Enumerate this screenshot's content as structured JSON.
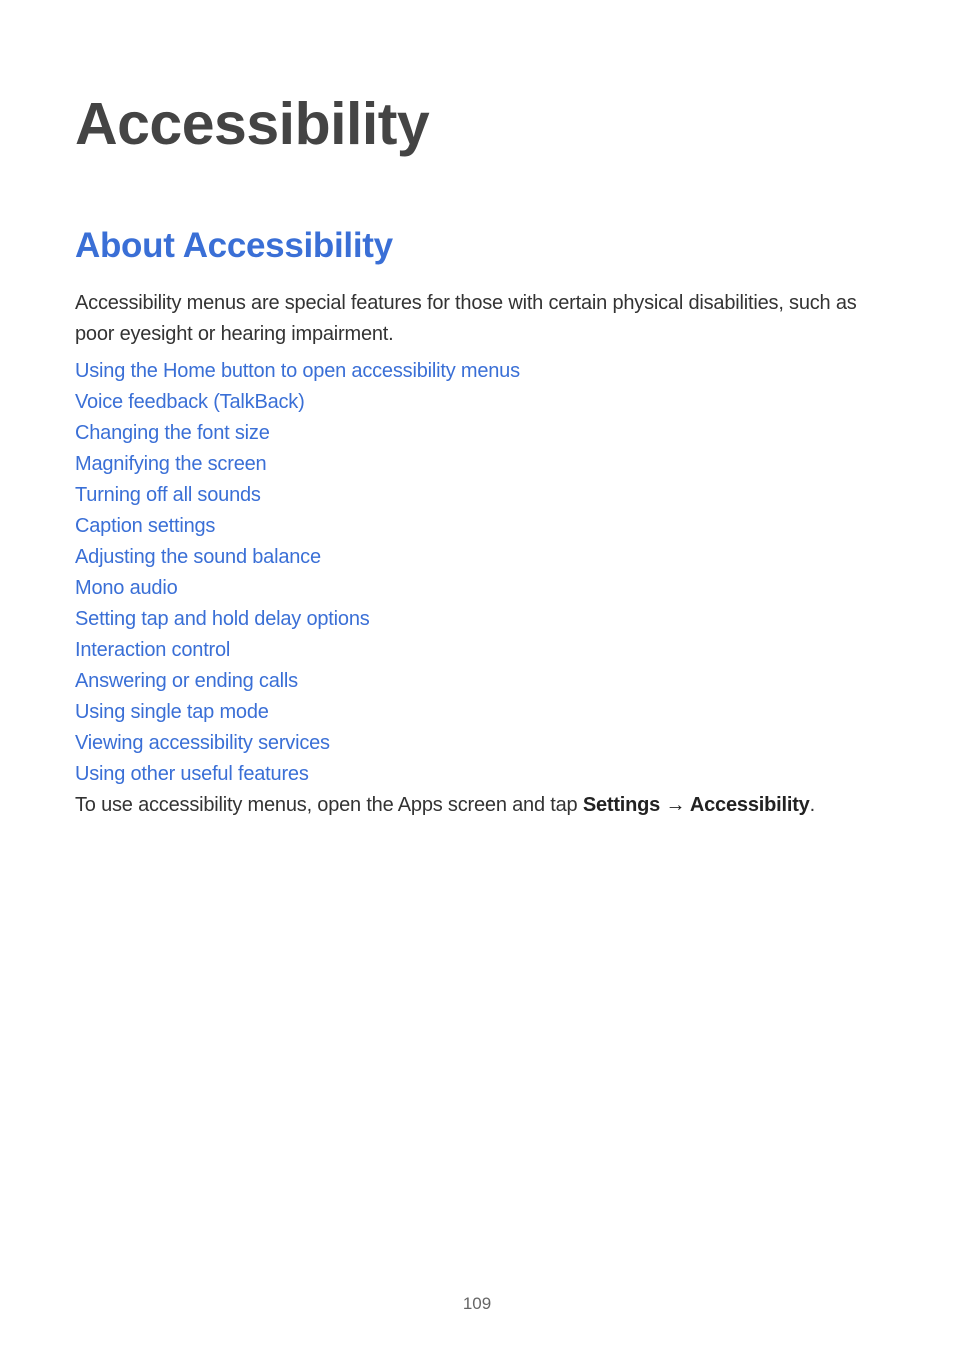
{
  "page": {
    "title": "Accessibility",
    "section_title": "About Accessibility",
    "intro": "Accessibility menus are special features for those with certain physical disabilities, such as poor eyesight or hearing impairment.",
    "links": [
      "Using the Home button to open accessibility menus",
      "Voice feedback (TalkBack)",
      "Changing the font size",
      "Magnifying the screen",
      "Turning off all sounds",
      "Caption settings",
      "Adjusting the sound balance",
      "Mono audio",
      "Setting tap and hold delay options",
      "Interaction control",
      "Answering or ending calls",
      "Using single tap mode",
      "Viewing accessibility services",
      "Using other useful features"
    ],
    "footer_prefix": "To use accessibility menus, open the Apps screen and tap ",
    "footer_bold1": "Settings",
    "footer_arrow": " → ",
    "footer_bold2": "Accessibility",
    "footer_period": ".",
    "page_number": "109"
  }
}
